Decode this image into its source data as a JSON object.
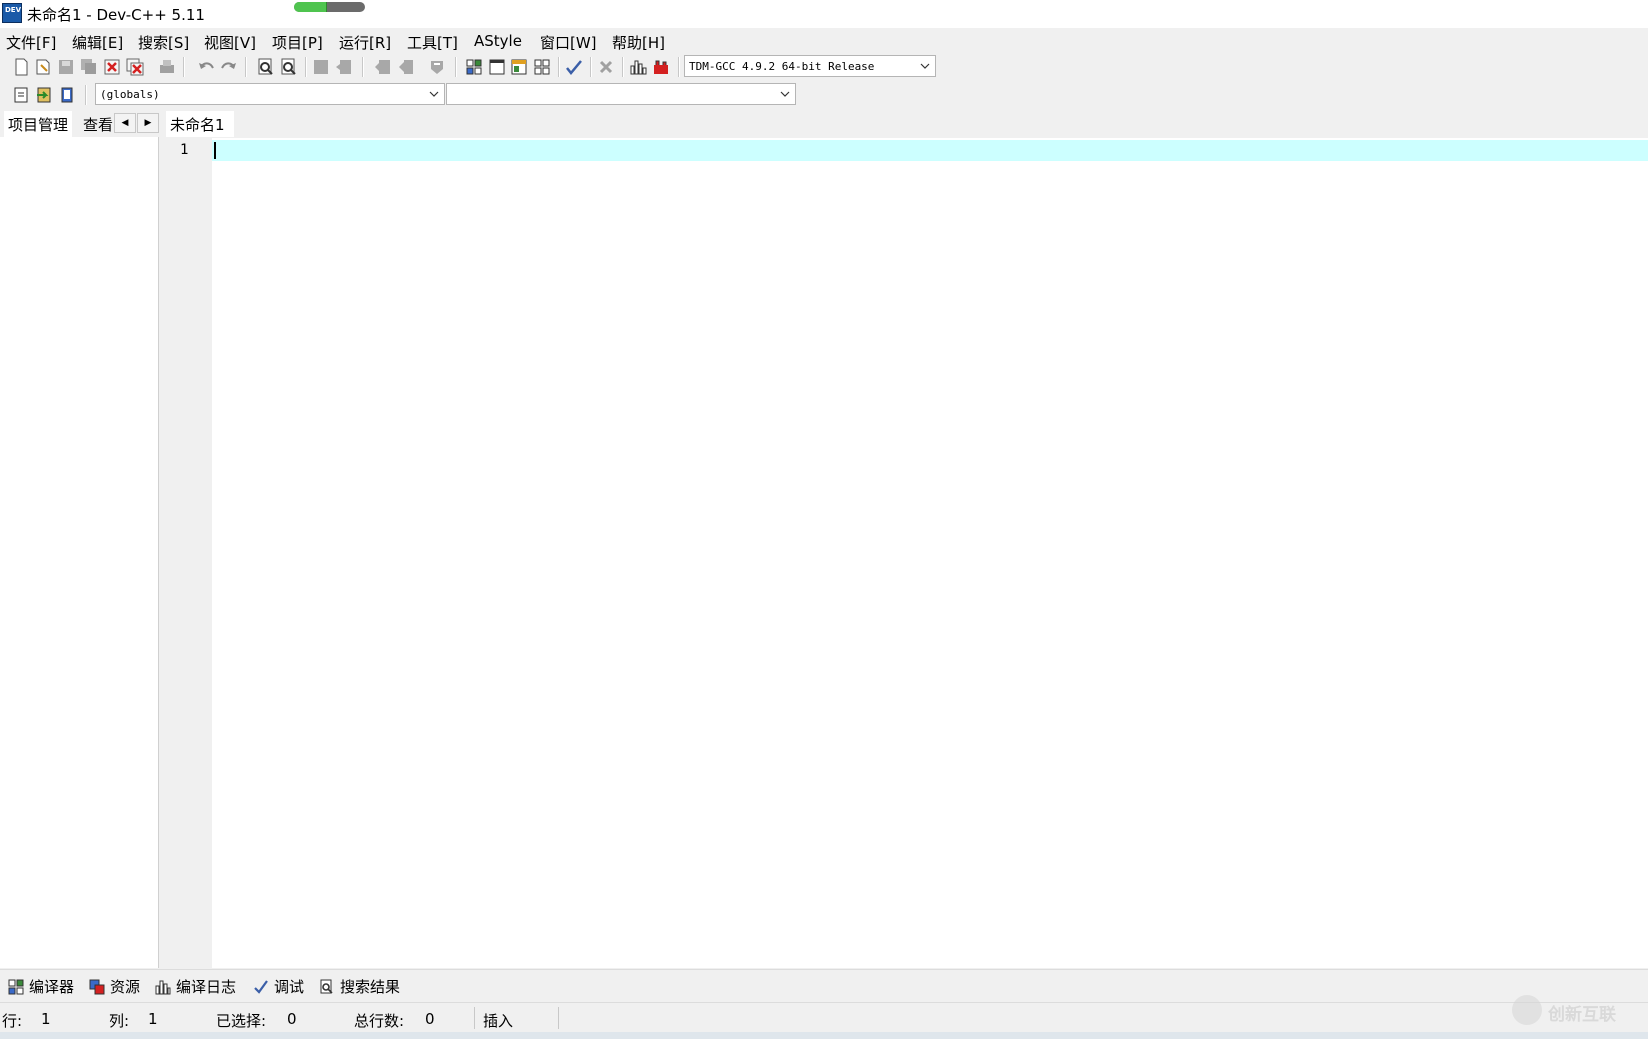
{
  "window": {
    "title": "未命名1 - Dev-C++ 5.11",
    "progress": 0.45
  },
  "menu": [
    "文件[F]",
    "编辑[E]",
    "搜索[S]",
    "视图[V]",
    "项目[P]",
    "运行[R]",
    "工具[T]",
    "AStyle",
    "窗口[W]",
    "帮助[H]"
  ],
  "toolbar": {
    "compiler_select": "TDM-GCC 4.9.2 64-bit Release",
    "scope_select": "(globals)",
    "member_select": ""
  },
  "left_panel": {
    "tabs": [
      "项目管理",
      "查看"
    ]
  },
  "editor": {
    "tab": "未命名1",
    "line_numbers": [
      "1"
    ]
  },
  "bottom_tabs": [
    "编译器",
    "资源",
    "编译日志",
    "调试",
    "搜索结果"
  ],
  "status": {
    "line_label": "行:",
    "line_value": "1",
    "col_label": "列:",
    "col_value": "1",
    "sel_label": "已选择:",
    "sel_value": "0",
    "total_label": "总行数:",
    "total_value": "0",
    "mode": "插入"
  },
  "watermark": {
    "text": "创新互联"
  }
}
